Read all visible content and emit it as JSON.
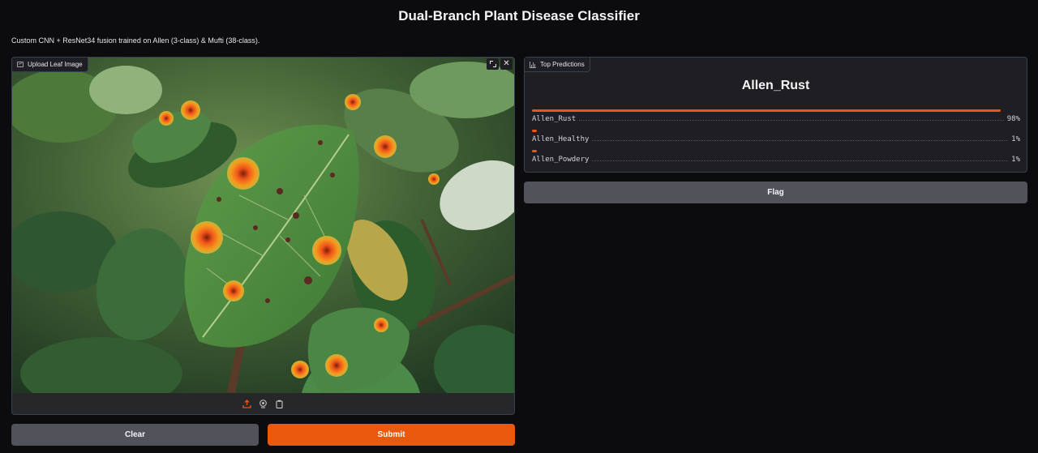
{
  "app": {
    "title": "Dual-Branch Plant Disease Classifier",
    "subtitle": "Custom CNN + ResNet34 fusion trained on Allen (3-class) & Mufti (38-class)."
  },
  "image_input": {
    "label": "Upload Leaf Image",
    "label_icon": "image-icon",
    "toolbar": [
      "expand-icon",
      "close-icon"
    ],
    "footer_icons": [
      "upload-icon",
      "webcam-icon",
      "clipboard-icon"
    ]
  },
  "buttons": {
    "clear": "Clear",
    "submit": "Submit",
    "flag": "Flag"
  },
  "predictions": {
    "label": "Top Predictions",
    "label_icon": "bar-chart-icon",
    "top": "Allen_Rust",
    "items": [
      {
        "name": "Allen_Rust",
        "percent": "98%",
        "fraction": 0.98
      },
      {
        "name": "Allen_Healthy",
        "percent": "1%",
        "fraction": 0.01
      },
      {
        "name": "Allen_Powdery",
        "percent": "1%",
        "fraction": 0.01
      }
    ]
  },
  "colors": {
    "accent": "#ea580c",
    "background": "#0c0c0f",
    "panel": "#1f1f23",
    "secondary_button": "#52525b"
  }
}
